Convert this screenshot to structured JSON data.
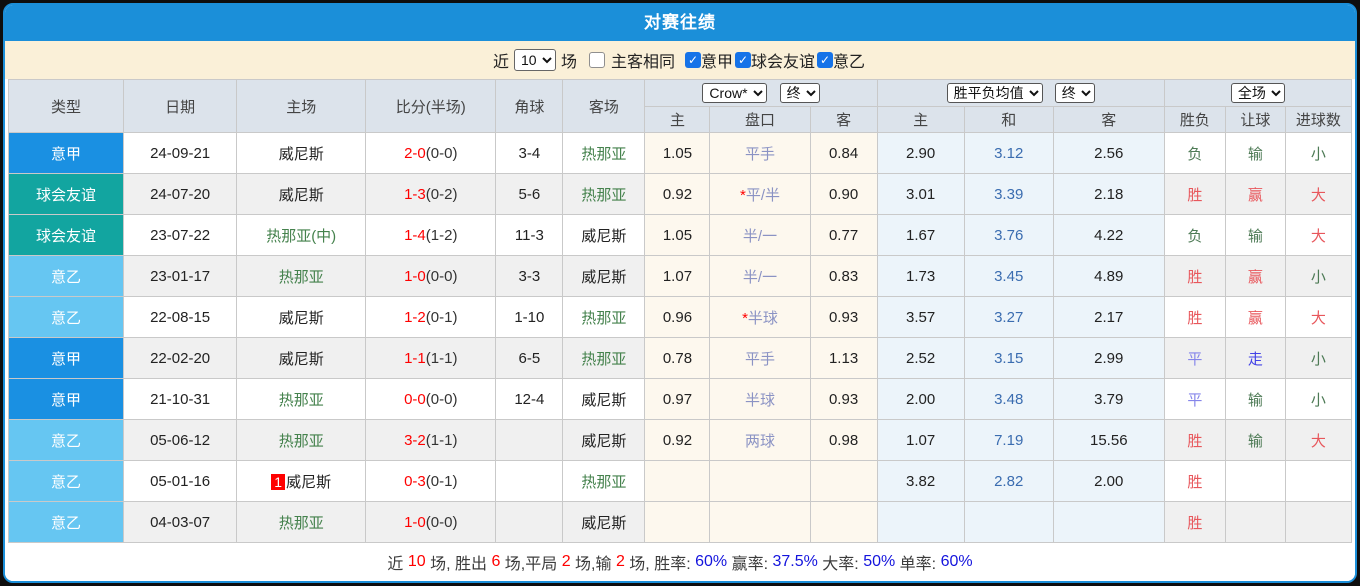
{
  "title": "对赛往绩",
  "colors": {
    "accent_blue": "#1b8fd9",
    "league_serie_a": "#1a90e2",
    "league_friendly": "#12a5a0",
    "league_serie_b": "#66c6f2",
    "control_bar_bg": "#faf0d8",
    "header_bg": "#dce3eb",
    "odds_col_bg": "#fdf8ee",
    "avg_col_bg": "#ecf4fa"
  },
  "controls": {
    "near_label": "近",
    "count_value": "10",
    "games_label": "场",
    "same_venue_label": "主客相同",
    "same_venue_checked": false,
    "filters": [
      {
        "label": "意甲",
        "checked": true
      },
      {
        "label": "球会友谊",
        "checked": true
      },
      {
        "label": "意乙",
        "checked": true
      }
    ]
  },
  "table": {
    "static_headers": [
      "类型",
      "日期",
      "主场",
      "比分(半场)",
      "角球",
      "客场"
    ],
    "groups": [
      {
        "selects": [
          "Crow*",
          "终"
        ]
      },
      {
        "selects": [
          "胜平负均值",
          "终"
        ]
      },
      {
        "selects": [
          "全场"
        ]
      }
    ],
    "sub_headers": [
      "主",
      "盘口",
      "客",
      "主",
      "和",
      "客",
      "胜负",
      "让球",
      "进球数"
    ],
    "rows": [
      {
        "league": {
          "text": "意甲",
          "type": "jia"
        },
        "date": "24-09-21",
        "home": {
          "text": "威尼斯",
          "green": false,
          "badge": ""
        },
        "score": {
          "full": "2-0",
          "half": "(0-0)"
        },
        "corner": "3-4",
        "away": {
          "text": "热那亚",
          "green": true
        },
        "odds": {
          "home": "1.05",
          "star": false,
          "handicap": "平手",
          "away": "0.84"
        },
        "avg": {
          "home": "2.90",
          "draw": "3.12",
          "away": "2.56"
        },
        "result": {
          "text": "负",
          "color": "green"
        },
        "handicap_result": {
          "text": "输",
          "color": "green"
        },
        "goals": {
          "text": "小",
          "color": "green"
        }
      },
      {
        "league": {
          "text": "球会友谊",
          "type": "yy"
        },
        "date": "24-07-20",
        "home": {
          "text": "威尼斯",
          "green": false,
          "badge": ""
        },
        "score": {
          "full": "1-3",
          "half": "(0-2)"
        },
        "corner": "5-6",
        "away": {
          "text": "热那亚",
          "green": true
        },
        "odds": {
          "home": "0.92",
          "star": true,
          "handicap": "平/半",
          "away": "0.90"
        },
        "avg": {
          "home": "3.01",
          "draw": "3.39",
          "away": "2.18"
        },
        "result": {
          "text": "胜",
          "color": "red"
        },
        "handicap_result": {
          "text": "赢",
          "color": "red"
        },
        "goals": {
          "text": "大",
          "color": "red"
        }
      },
      {
        "league": {
          "text": "球会友谊",
          "type": "yy"
        },
        "date": "23-07-22",
        "home": {
          "text": "热那亚(中)",
          "green": true,
          "badge": ""
        },
        "score": {
          "full": "1-4",
          "half": "(1-2)"
        },
        "corner": "11-3",
        "away": {
          "text": "威尼斯",
          "green": false
        },
        "odds": {
          "home": "1.05",
          "star": false,
          "handicap": "半/一",
          "away": "0.77"
        },
        "avg": {
          "home": "1.67",
          "draw": "3.76",
          "away": "4.22"
        },
        "result": {
          "text": "负",
          "color": "green"
        },
        "handicap_result": {
          "text": "输",
          "color": "green"
        },
        "goals": {
          "text": "大",
          "color": "red"
        }
      },
      {
        "league": {
          "text": "意乙",
          "type": "yi"
        },
        "date": "23-01-17",
        "home": {
          "text": "热那亚",
          "green": true,
          "badge": ""
        },
        "score": {
          "full": "1-0",
          "half": "(0-0)"
        },
        "corner": "3-3",
        "away": {
          "text": "威尼斯",
          "green": false
        },
        "odds": {
          "home": "1.07",
          "star": false,
          "handicap": "半/一",
          "away": "0.83"
        },
        "avg": {
          "home": "1.73",
          "draw": "3.45",
          "away": "4.89"
        },
        "result": {
          "text": "胜",
          "color": "red"
        },
        "handicap_result": {
          "text": "赢",
          "color": "red"
        },
        "goals": {
          "text": "小",
          "color": "green"
        }
      },
      {
        "league": {
          "text": "意乙",
          "type": "yi"
        },
        "date": "22-08-15",
        "home": {
          "text": "威尼斯",
          "green": false,
          "badge": ""
        },
        "score": {
          "full": "1-2",
          "half": "(0-1)"
        },
        "corner": "1-10",
        "away": {
          "text": "热那亚",
          "green": true
        },
        "odds": {
          "home": "0.96",
          "star": true,
          "handicap": "半球",
          "away": "0.93"
        },
        "avg": {
          "home": "3.57",
          "draw": "3.27",
          "away": "2.17"
        },
        "result": {
          "text": "胜",
          "color": "red"
        },
        "handicap_result": {
          "text": "赢",
          "color": "red"
        },
        "goals": {
          "text": "大",
          "color": "red"
        }
      },
      {
        "league": {
          "text": "意甲",
          "type": "jia"
        },
        "date": "22-02-20",
        "home": {
          "text": "威尼斯",
          "green": false,
          "badge": ""
        },
        "score": {
          "full": "1-1",
          "half": "(1-1)"
        },
        "corner": "6-5",
        "away": {
          "text": "热那亚",
          "green": true
        },
        "odds": {
          "home": "0.78",
          "star": false,
          "handicap": "平手",
          "away": "1.13"
        },
        "avg": {
          "home": "2.52",
          "draw": "3.15",
          "away": "2.99"
        },
        "result": {
          "text": "平",
          "color": "bluel"
        },
        "handicap_result": {
          "text": "走",
          "color": "blue"
        },
        "goals": {
          "text": "小",
          "color": "green"
        }
      },
      {
        "league": {
          "text": "意甲",
          "type": "jia"
        },
        "date": "21-10-31",
        "home": {
          "text": "热那亚",
          "green": true,
          "badge": ""
        },
        "score": {
          "full": "0-0",
          "half": "(0-0)"
        },
        "corner": "12-4",
        "away": {
          "text": "威尼斯",
          "green": false
        },
        "odds": {
          "home": "0.97",
          "star": false,
          "handicap": "半球",
          "away": "0.93"
        },
        "avg": {
          "home": "2.00",
          "draw": "3.48",
          "away": "3.79"
        },
        "result": {
          "text": "平",
          "color": "bluel"
        },
        "handicap_result": {
          "text": "输",
          "color": "green"
        },
        "goals": {
          "text": "小",
          "color": "green"
        }
      },
      {
        "league": {
          "text": "意乙",
          "type": "yi"
        },
        "date": "05-06-12",
        "home": {
          "text": "热那亚",
          "green": true,
          "badge": ""
        },
        "score": {
          "full": "3-2",
          "half": "(1-1)"
        },
        "corner": "",
        "away": {
          "text": "威尼斯",
          "green": false
        },
        "odds": {
          "home": "0.92",
          "star": false,
          "handicap": "两球",
          "away": "0.98"
        },
        "avg": {
          "home": "1.07",
          "draw": "7.19",
          "away": "15.56"
        },
        "result": {
          "text": "胜",
          "color": "red"
        },
        "handicap_result": {
          "text": "输",
          "color": "green"
        },
        "goals": {
          "text": "大",
          "color": "red"
        }
      },
      {
        "league": {
          "text": "意乙",
          "type": "yi"
        },
        "date": "05-01-16",
        "home": {
          "text": "威尼斯",
          "green": false,
          "badge": "1"
        },
        "score": {
          "full": "0-3",
          "half": "(0-1)"
        },
        "corner": "",
        "away": {
          "text": "热那亚",
          "green": true
        },
        "odds": {
          "home": "",
          "star": false,
          "handicap": "",
          "away": ""
        },
        "avg": {
          "home": "3.82",
          "draw": "2.82",
          "away": "2.00"
        },
        "result": {
          "text": "胜",
          "color": "red"
        },
        "handicap_result": {
          "text": "",
          "color": ""
        },
        "goals": {
          "text": "",
          "color": ""
        }
      },
      {
        "league": {
          "text": "意乙",
          "type": "yi"
        },
        "date": "04-03-07",
        "home": {
          "text": "热那亚",
          "green": true,
          "badge": ""
        },
        "score": {
          "full": "1-0",
          "half": "(0-0)"
        },
        "corner": "",
        "away": {
          "text": "威尼斯",
          "green": false
        },
        "odds": {
          "home": "",
          "star": false,
          "handicap": "",
          "away": ""
        },
        "avg": {
          "home": "",
          "draw": "",
          "away": ""
        },
        "result": {
          "text": "胜",
          "color": "red"
        },
        "handicap_result": {
          "text": "",
          "color": ""
        },
        "goals": {
          "text": "",
          "color": ""
        }
      }
    ]
  },
  "footer": {
    "segments": [
      {
        "text": "近 ",
        "color": "dark"
      },
      {
        "text": "10",
        "color": "red"
      },
      {
        "text": " 场, 胜出 ",
        "color": "dark"
      },
      {
        "text": "6",
        "color": "red"
      },
      {
        "text": " 场,平局 ",
        "color": "dark"
      },
      {
        "text": "2",
        "color": "red"
      },
      {
        "text": " 场,输 ",
        "color": "dark"
      },
      {
        "text": "2",
        "color": "red"
      },
      {
        "text": " 场, 胜率: ",
        "color": "dark"
      },
      {
        "text": "60%",
        "color": "blue"
      },
      {
        "text": " 赢率: ",
        "color": "dark"
      },
      {
        "text": "37.5%",
        "color": "blue"
      },
      {
        "text": " 大率: ",
        "color": "dark"
      },
      {
        "text": "50%",
        "color": "blue"
      },
      {
        "text": " 单率: ",
        "color": "dark"
      },
      {
        "text": "60%",
        "color": "blue"
      }
    ]
  }
}
